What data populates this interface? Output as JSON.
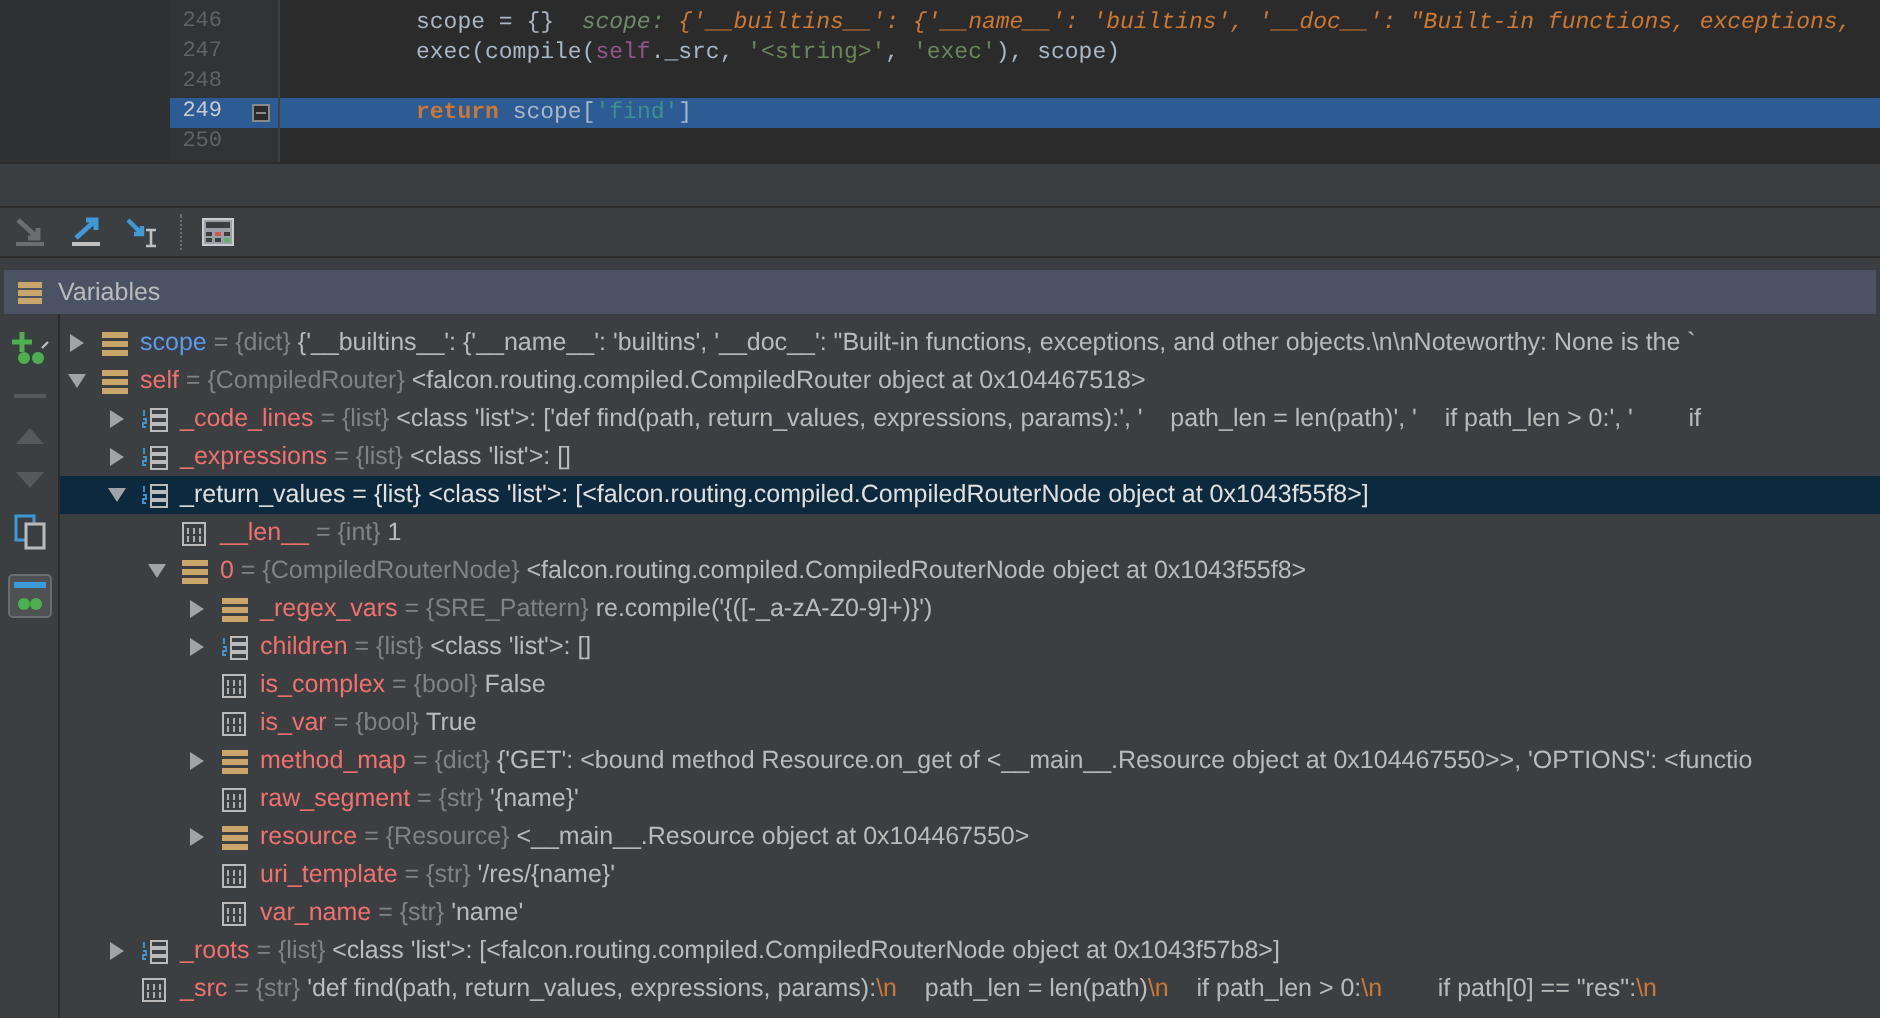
{
  "editor": {
    "lines": [
      {
        "number": "246",
        "selected": false,
        "segments": [
          {
            "kind": "plain",
            "text": "scope = {}"
          },
          {
            "kind": "hint_label",
            "text": "  scope: "
          },
          {
            "kind": "hint",
            "text": "{'__builtins__': {'__name__': 'builtins', '__doc__': \"Built-in functions, exceptions,"
          }
        ]
      },
      {
        "number": "247",
        "selected": false,
        "segments": [
          {
            "kind": "plain",
            "text": "exec(compile("
          },
          {
            "kind": "self",
            "text": "self"
          },
          {
            "kind": "plain",
            "text": "._src, "
          },
          {
            "kind": "string",
            "text": "'<string>'"
          },
          {
            "kind": "plain",
            "text": ", "
          },
          {
            "kind": "string",
            "text": "'exec'"
          },
          {
            "kind": "plain",
            "text": "), scope)"
          }
        ]
      },
      {
        "number": "248",
        "selected": false
      },
      {
        "number": "249",
        "selected": true,
        "segments": [
          {
            "kind": "keyword",
            "text": "return"
          },
          {
            "kind": "plain",
            "text": " scope["
          },
          {
            "kind": "string",
            "text": "'find'"
          },
          {
            "kind": "plain",
            "text": "]"
          }
        ]
      },
      {
        "number": "250",
        "selected": false
      }
    ]
  },
  "panel": {
    "title": "Variables"
  },
  "tree": [
    {
      "name": "scope",
      "color": "#5d9bec",
      "kind": "dict",
      "type": "= {dict}",
      "value": "{'__builtins__': {'__name__': 'builtins', '__doc__': \"Built-in functions, exceptions, and other objects.\\n\\nNoteworthy: None is the `",
      "expanded": false,
      "selected": false
    },
    {
      "name": "self",
      "color": "#f0716e",
      "kind": "dict",
      "type": "= {CompiledRouter}",
      "value": "<falcon.routing.compiled.CompiledRouter object at 0x104467518>",
      "expanded": true,
      "selected": false,
      "children": [
        {
          "name": "_code_lines",
          "color": "#f0716e",
          "kind": "list",
          "type": "= {list}",
          "value": "<class 'list'>: ['def find(path, return_values, expressions, params):', '    path_len = len(path)', '    if path_len > 0:', '        if",
          "expanded": false,
          "selected": false
        },
        {
          "name": "_expressions",
          "color": "#f0716e",
          "kind": "list",
          "type": "= {list}",
          "value": "<class 'list'>: []",
          "expanded": false,
          "selected": false
        },
        {
          "name": "_return_values",
          "kind": "list",
          "type": "= {list}",
          "value": "<class 'list'>: [<falcon.routing.compiled.CompiledRouterNode object at 0x1043f55f8>]",
          "expanded": true,
          "selected": true,
          "children": [
            {
              "name": "__len__",
              "color": "#f0716e",
              "kind": "primitive",
              "type": "= {int}",
              "value": "1",
              "selected": false
            },
            {
              "name": "0",
              "color": "#f0716e",
              "kind": "dict",
              "type": "= {CompiledRouterNode}",
              "value": "<falcon.routing.compiled.CompiledRouterNode object at 0x1043f55f8>",
              "expanded": true,
              "selected": false,
              "children": [
                {
                  "name": "_regex_vars",
                  "color": "#f0716e",
                  "kind": "dict",
                  "type": "= {SRE_Pattern}",
                  "value": "re.compile('{([-_a-zA-Z0-9]+)}')",
                  "expanded": false,
                  "selected": false
                },
                {
                  "name": "children",
                  "color": "#f0716e",
                  "kind": "list",
                  "type": "= {list}",
                  "value": "<class 'list'>: []",
                  "expanded": false,
                  "selected": false
                },
                {
                  "name": "is_complex",
                  "color": "#f0716e",
                  "kind": "primitive",
                  "type": "= {bool}",
                  "value": "False",
                  "selected": false
                },
                {
                  "name": "is_var",
                  "color": "#f0716e",
                  "kind": "primitive",
                  "type": "= {bool}",
                  "value": "True",
                  "selected": false
                },
                {
                  "name": "method_map",
                  "color": "#f0716e",
                  "kind": "dict",
                  "type": "= {dict}",
                  "value": "{'GET': <bound method Resource.on_get of <__main__.Resource object at 0x104467550>>, 'OPTIONS': <functio",
                  "expanded": false,
                  "selected": false
                },
                {
                  "name": "raw_segment",
                  "color": "#f0716e",
                  "kind": "primitive",
                  "type": "= {str}",
                  "value": "'{name}'",
                  "selected": false
                },
                {
                  "name": "resource",
                  "color": "#f0716e",
                  "kind": "dict",
                  "type": "= {Resource}",
                  "value": "<__main__.Resource object at 0x104467550>",
                  "expanded": false,
                  "selected": false
                },
                {
                  "name": "uri_template",
                  "color": "#f0716e",
                  "kind": "primitive",
                  "type": "= {str}",
                  "value": "'/res/{name}'",
                  "selected": false
                },
                {
                  "name": "var_name",
                  "color": "#f0716e",
                  "kind": "primitive",
                  "type": "= {str}",
                  "value": "'name'",
                  "selected": false
                }
              ]
            }
          ]
        },
        {
          "name": "_roots",
          "color": "#f0716e",
          "kind": "list",
          "type": "= {list}",
          "value": "<class 'list'>: [<falcon.routing.compiled.CompiledRouterNode object at 0x1043f57b8>]",
          "expanded": false,
          "selected": false
        },
        {
          "name": "_src",
          "color": "#f0716e",
          "kind": "primitive",
          "type": "= {str}",
          "value": [
            {
              "kind": "plain",
              "text": "'def find(path, return_values, expressions, params):"
            },
            {
              "kind": "escape",
              "text": "\\n"
            },
            {
              "kind": "plain",
              "text": "    path_len = len(path)"
            },
            {
              "kind": "escape",
              "text": "\\n"
            },
            {
              "kind": "plain",
              "text": "    if path_len > 0:"
            },
            {
              "kind": "escape",
              "text": "\\n"
            },
            {
              "kind": "plain",
              "text": "        if path[0] == \"res\":"
            },
            {
              "kind": "escape",
              "text": "\\n"
            }
          ],
          "selected": false
        }
      ]
    }
  ]
}
